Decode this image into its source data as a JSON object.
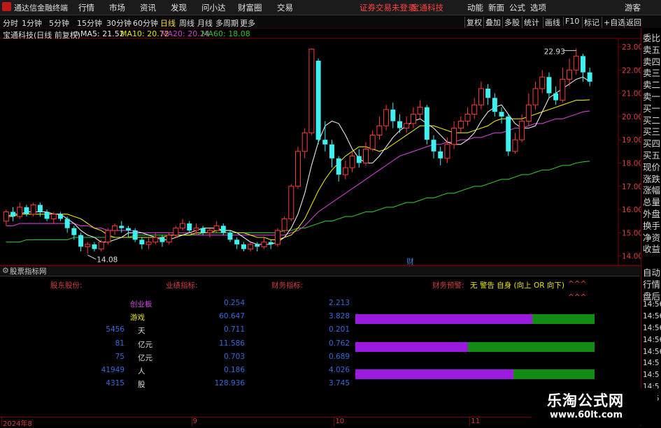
{
  "menubar": {
    "title": "通达信金融终端",
    "items": [
      "行情",
      "市场",
      "资讯",
      "发现",
      "问小达",
      "财富圈",
      "交易"
    ],
    "notice": "证券交易未登录",
    "stock_name": "宝通科技",
    "right_items": [
      "动能",
      "新面",
      "公式",
      "选项"
    ],
    "guest": "游客"
  },
  "toolbar": {
    "periods": [
      "分时",
      "1分钟",
      "5分钟",
      "15分钟",
      "30分钟",
      "60分钟",
      "日线",
      "周线",
      "月线",
      "多周期",
      "更多"
    ],
    "active_period": "日线",
    "buttons": [
      "复权",
      "叠加",
      "多股",
      "统计",
      "画线",
      "F10",
      "标记",
      "+自选",
      "返回"
    ]
  },
  "chart_header": {
    "title": "宝通科技(日线 前复权)",
    "ma5": "MA5: 21.52",
    "ma10": "MA10: 20.72",
    "ma20": "MA20: 20.24",
    "ma60": "MA60: 18.08"
  },
  "colors": {
    "up": "#ff3b3b",
    "down": "#3ff0f0",
    "ma5": "#e8e8e8",
    "ma10": "#e6e600",
    "ma20": "#d040d0",
    "ma60": "#30c030",
    "axis_text": "#e04040"
  },
  "chart_data": {
    "type": "candlestick",
    "ylim": [
      13.6,
      23.3
    ],
    "yticks": [
      "23.00",
      "22.00",
      "21.00",
      "20.00",
      "19.00",
      "18.00",
      "17.00",
      "16.00",
      "15.00",
      "14.00"
    ],
    "ytick_values": [
      23,
      22,
      21,
      20,
      19,
      18,
      17,
      16,
      15,
      14
    ],
    "high_label": "22.93",
    "low_label": "14.08",
    "marker": "财",
    "x_labels": [
      "2024年8",
      "9",
      "10",
      "11"
    ],
    "x_label_index": [
      0,
      28,
      49,
      69
    ],
    "candles": [
      [
        15.5,
        15.9,
        15.3,
        16.0
      ],
      [
        15.9,
        15.7,
        15.5,
        16.1
      ],
      [
        15.7,
        16.1,
        15.6,
        16.3
      ],
      [
        16.1,
        15.8,
        15.7,
        16.2
      ],
      [
        15.8,
        16.2,
        15.7,
        16.3
      ],
      [
        16.2,
        15.9,
        15.7,
        16.3
      ],
      [
        15.9,
        15.6,
        15.5,
        16.0
      ],
      [
        15.6,
        15.8,
        15.4,
        15.9
      ],
      [
        15.8,
        15.6,
        15.5,
        15.9
      ],
      [
        15.6,
        15.2,
        15.0,
        15.7
      ],
      [
        15.2,
        14.9,
        14.7,
        15.3
      ],
      [
        14.9,
        14.4,
        14.2,
        15.0
      ],
      [
        14.4,
        14.5,
        14.1,
        14.6
      ],
      [
        14.5,
        14.3,
        14.2,
        14.6
      ],
      [
        14.3,
        14.6,
        14.2,
        14.7
      ],
      [
        14.6,
        15.1,
        14.5,
        15.2
      ],
      [
        15.1,
        15.3,
        14.9,
        15.4
      ],
      [
        15.3,
        15.2,
        15.0,
        15.5
      ],
      [
        15.2,
        15.1,
        14.8,
        15.3
      ],
      [
        15.1,
        14.7,
        14.6,
        15.2
      ],
      [
        14.7,
        14.5,
        14.3,
        14.8
      ],
      [
        14.5,
        14.6,
        14.3,
        14.8
      ],
      [
        14.6,
        14.8,
        14.5,
        15.0
      ],
      [
        14.8,
        14.6,
        14.4,
        14.9
      ],
      [
        14.6,
        14.9,
        14.5,
        15.0
      ],
      [
        14.9,
        15.2,
        14.8,
        15.3
      ],
      [
        15.2,
        15.4,
        15.1,
        15.6
      ],
      [
        15.4,
        15.1,
        15.0,
        15.5
      ],
      [
        15.1,
        15.2,
        14.9,
        15.4
      ],
      [
        15.2,
        15.0,
        14.9,
        15.3
      ],
      [
        15.0,
        15.1,
        14.8,
        15.2
      ],
      [
        15.1,
        15.3,
        15.0,
        15.5
      ],
      [
        15.3,
        15.0,
        14.9,
        15.4
      ],
      [
        15.0,
        14.7,
        14.6,
        15.1
      ],
      [
        14.7,
        14.5,
        14.3,
        14.8
      ],
      [
        14.5,
        14.3,
        14.2,
        14.6
      ],
      [
        14.3,
        14.5,
        14.2,
        14.6
      ],
      [
        14.5,
        14.4,
        14.2,
        14.6
      ],
      [
        14.4,
        14.6,
        14.3,
        14.8
      ],
      [
        14.6,
        14.5,
        14.3,
        14.7
      ],
      [
        14.5,
        15.1,
        14.4,
        15.2
      ],
      [
        15.1,
        15.6,
        15.0,
        15.7
      ],
      [
        15.6,
        17.0,
        15.5,
        17.1
      ],
      [
        17.0,
        18.5,
        16.9,
        18.7
      ],
      [
        18.5,
        19.3,
        18.2,
        19.5
      ],
      [
        19.3,
        22.9,
        19.2,
        22.93
      ],
      [
        22.4,
        19.0,
        18.8,
        22.5
      ],
      [
        19.0,
        18.8,
        18.5,
        19.8
      ],
      [
        18.8,
        18.2,
        17.8,
        19.0
      ],
      [
        18.2,
        17.5,
        17.2,
        18.3
      ],
      [
        17.5,
        17.8,
        17.3,
        18.1
      ],
      [
        17.8,
        18.3,
        17.6,
        18.5
      ],
      [
        18.3,
        18.0,
        17.8,
        18.6
      ],
      [
        18.0,
        18.6,
        17.9,
        18.9
      ],
      [
        18.6,
        19.2,
        18.5,
        19.4
      ],
      [
        19.2,
        19.6,
        19.0,
        20.0
      ],
      [
        19.6,
        20.3,
        19.4,
        20.5
      ],
      [
        20.3,
        19.8,
        19.5,
        20.6
      ],
      [
        19.8,
        19.5,
        19.3,
        20.1
      ],
      [
        19.5,
        19.7,
        19.3,
        20.0
      ],
      [
        19.7,
        20.1,
        19.5,
        20.4
      ],
      [
        20.1,
        20.4,
        19.9,
        20.7
      ],
      [
        20.4,
        19.0,
        18.8,
        20.5
      ],
      [
        19.0,
        18.5,
        18.2,
        19.2
      ],
      [
        18.5,
        18.2,
        17.9,
        18.7
      ],
      [
        18.2,
        18.8,
        18.0,
        19.1
      ],
      [
        18.8,
        19.5,
        18.6,
        19.8
      ],
      [
        19.5,
        19.8,
        19.3,
        20.0
      ],
      [
        19.8,
        20.1,
        19.6,
        20.4
      ],
      [
        20.1,
        20.5,
        19.9,
        20.8
      ],
      [
        20.5,
        21.2,
        20.3,
        21.5
      ],
      [
        21.2,
        20.8,
        20.5,
        21.4
      ],
      [
        20.8,
        20.2,
        20.0,
        21.0
      ],
      [
        20.2,
        20.0,
        19.7,
        20.4
      ],
      [
        20.0,
        18.5,
        18.3,
        20.1
      ],
      [
        18.5,
        19.0,
        18.4,
        19.3
      ],
      [
        19.0,
        19.8,
        18.9,
        20.1
      ],
      [
        19.8,
        20.5,
        19.6,
        21.0
      ],
      [
        20.5,
        21.2,
        20.3,
        21.5
      ],
      [
        21.2,
        21.7,
        21.0,
        22.0
      ],
      [
        21.7,
        21.0,
        20.8,
        21.9
      ],
      [
        21.0,
        20.7,
        20.5,
        21.3
      ],
      [
        20.7,
        21.6,
        20.6,
        22.1
      ],
      [
        21.6,
        22.0,
        21.3,
        22.5
      ],
      [
        22.0,
        22.6,
        21.8,
        22.93
      ],
      [
        22.6,
        21.9,
        21.5,
        22.7
      ],
      [
        21.9,
        21.5,
        21.3,
        22.1
      ]
    ],
    "ma5": [
      15.7,
      15.8,
      15.8,
      15.9,
      15.9,
      15.9,
      15.9,
      15.8,
      15.8,
      15.6,
      15.4,
      15.1,
      14.9,
      14.8,
      14.6,
      14.6,
      14.7,
      14.8,
      15.0,
      15.0,
      15.0,
      14.9,
      14.8,
      14.7,
      14.7,
      14.8,
      14.9,
      15.0,
      15.1,
      15.2,
      15.2,
      15.2,
      15.1,
      15.1,
      15.0,
      14.8,
      14.6,
      14.5,
      14.5,
      14.5,
      14.6,
      14.8,
      15.2,
      15.8,
      16.7,
      17.9,
      18.9,
      19.6,
      19.8,
      19.7,
      19.2,
      18.6,
      18.2,
      18.0,
      18.0,
      18.3,
      18.7,
      19.1,
      19.4,
      19.6,
      19.8,
      19.9,
      19.7,
      19.5,
      19.2,
      18.9,
      18.8,
      18.8,
      19.0,
      19.3,
      19.8,
      20.2,
      20.4,
      20.5,
      20.1,
      19.7,
      19.5,
      19.5,
      19.6,
      20.2,
      20.8,
      21.0,
      21.2,
      21.4,
      21.6,
      21.7,
      21.5
    ],
    "ma10": [
      15.7,
      15.7,
      15.8,
      15.8,
      15.8,
      15.8,
      15.8,
      15.8,
      15.8,
      15.8,
      15.7,
      15.6,
      15.4,
      15.2,
      15.1,
      14.9,
      14.8,
      14.8,
      14.8,
      14.8,
      14.8,
      14.8,
      14.8,
      14.8,
      14.9,
      14.9,
      14.9,
      14.9,
      15.0,
      15.0,
      15.0,
      15.1,
      15.1,
      15.1,
      15.0,
      15.0,
      14.9,
      14.8,
      14.8,
      14.7,
      14.7,
      14.8,
      14.9,
      15.2,
      15.6,
      16.2,
      16.8,
      17.3,
      17.7,
      18.0,
      18.3,
      18.5,
      18.7,
      18.7,
      18.6,
      18.5,
      18.6,
      18.8,
      19.0,
      19.2,
      19.4,
      19.6,
      19.6,
      19.6,
      19.5,
      19.4,
      19.3,
      19.3,
      19.3,
      19.4,
      19.5,
      19.6,
      19.8,
      19.9,
      19.9,
      19.9,
      19.9,
      20.0,
      20.1,
      20.2,
      20.3,
      20.4,
      20.5,
      20.6,
      20.7,
      20.7,
      20.72
    ],
    "ma20": [
      15.3,
      15.3,
      15.4,
      15.4,
      15.4,
      15.4,
      15.4,
      15.4,
      15.4,
      15.4,
      15.4,
      15.3,
      15.3,
      15.2,
      15.2,
      15.1,
      15.1,
      15.1,
      15.1,
      15.1,
      15.0,
      15.0,
      15.0,
      15.0,
      15.0,
      15.0,
      15.0,
      15.0,
      14.9,
      14.9,
      14.9,
      14.9,
      14.9,
      14.9,
      14.9,
      14.9,
      14.9,
      14.9,
      14.9,
      14.9,
      14.9,
      14.9,
      15.0,
      15.1,
      15.3,
      15.6,
      15.9,
      16.1,
      16.3,
      16.5,
      16.7,
      16.9,
      17.1,
      17.3,
      17.5,
      17.7,
      17.9,
      18.1,
      18.3,
      18.4,
      18.5,
      18.6,
      18.7,
      18.8,
      18.8,
      18.9,
      18.9,
      19.0,
      19.0,
      19.1,
      19.1,
      19.2,
      19.3,
      19.3,
      19.4,
      19.5,
      19.5,
      19.6,
      19.7,
      19.7,
      19.8,
      19.9,
      19.9,
      20.0,
      20.1,
      20.2,
      20.24
    ],
    "ma60": [
      14.6,
      14.6,
      14.6,
      14.7,
      14.7,
      14.7,
      14.7,
      14.7,
      14.7,
      14.7,
      14.8,
      14.8,
      14.8,
      14.8,
      14.8,
      14.8,
      14.8,
      14.8,
      14.8,
      14.9,
      14.9,
      14.9,
      14.9,
      14.9,
      14.9,
      14.9,
      14.9,
      14.9,
      14.9,
      15.0,
      15.0,
      15.0,
      15.0,
      15.0,
      15.0,
      15.0,
      15.0,
      15.0,
      15.0,
      15.0,
      15.0,
      15.1,
      15.1,
      15.2,
      15.2,
      15.3,
      15.4,
      15.5,
      15.5,
      15.6,
      15.7,
      15.7,
      15.8,
      15.9,
      15.9,
      16.0,
      16.1,
      16.1,
      16.2,
      16.3,
      16.3,
      16.4,
      16.5,
      16.5,
      16.6,
      16.7,
      16.7,
      16.8,
      16.9,
      17.0,
      17.0,
      17.1,
      17.2,
      17.3,
      17.3,
      17.4,
      17.5,
      17.5,
      17.6,
      17.7,
      17.7,
      17.8,
      17.9,
      17.9,
      18.0,
      18.05,
      18.08
    ]
  },
  "right_panel": {
    "items": [
      "委比",
      "卖五",
      "卖四",
      "卖三",
      "卖二",
      "卖一",
      "买一",
      "买二",
      "买三",
      "买四",
      "买五",
      "现价",
      "涨跌",
      "涨幅",
      "总量",
      "外盘",
      "换手",
      "净资",
      "收益",
      "",
      "自动",
      "行情",
      "盘后",
      "14:56",
      "14:56",
      "14:56",
      "14:56",
      "14:56",
      "14:5",
      "14:5",
      "14:5",
      "14:5"
    ]
  },
  "lower": {
    "title": "股票指标网",
    "headers": [
      "股东股份:",
      "业绩指标:",
      "财务指标:",
      "财务预警:"
    ],
    "warning_text": "无 警告 自身 (向上 OR 向下)",
    "warning_tail": "^^^",
    "warning_tail2": "^^^",
    "rows": [
      {
        "c1": "",
        "c2": "创业板",
        "c3": "0.254",
        "c4": "2.213"
      },
      {
        "c1": "",
        "c2": "游戏",
        "c3": "60.647",
        "c4": "3.828"
      },
      {
        "c1": "5456",
        "c2": "天",
        "c3": "0.711",
        "c4": "0.201"
      },
      {
        "c1": "81",
        "c2": "亿元",
        "c3": "11.586",
        "c4": "0.762"
      },
      {
        "c1": "75",
        "c2": "亿元",
        "c3": "0.703",
        "c4": "0.689"
      },
      {
        "c1": "41949",
        "c2": "人",
        "c3": "0.186",
        "c4": "4.026"
      },
      {
        "c1": "4315",
        "c2": "股",
        "c3": "128.936",
        "c4": "3.745"
      }
    ],
    "bars": [
      0.74,
      0.47,
      0.66
    ]
  },
  "watermark": {
    "line1": "乐淘公式网",
    "line2": "www.60lt.com"
  }
}
